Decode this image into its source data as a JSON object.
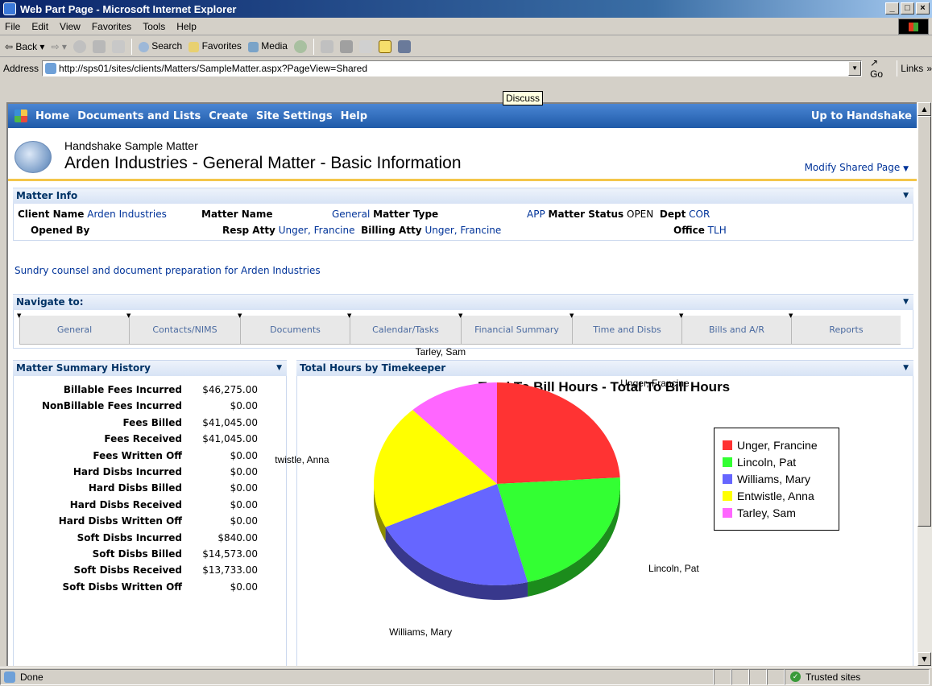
{
  "window": {
    "title": "Web Part Page - Microsoft Internet Explorer"
  },
  "menu": [
    "File",
    "Edit",
    "View",
    "Favorites",
    "Tools",
    "Help"
  ],
  "toolbar": {
    "back": "Back",
    "search": "Search",
    "favorites": "Favorites",
    "media": "Media"
  },
  "address": {
    "label": "Address",
    "url": "http://sps01/sites/clients/Matters/SampleMatter.aspx?PageView=Shared",
    "go": "Go",
    "links": "Links"
  },
  "tooltip": "Discuss",
  "topnav": {
    "items": [
      "Home",
      "Documents and Lists",
      "Create",
      "Site Settings",
      "Help"
    ],
    "right": "Up to Handshake"
  },
  "header": {
    "subtitle": "Handshake Sample Matter",
    "title": "Arden Industries - General Matter - Basic Information",
    "modify": "Modify Shared Page"
  },
  "matter_info": {
    "title": "Matter Info",
    "client_name_label": "Client Name",
    "client_name": "Arden Industries",
    "matter_name_label": "Matter Name",
    "matter_name": "General",
    "matter_type_label": "Matter Type",
    "matter_type": "APP",
    "matter_status_label": "Matter Status",
    "matter_status": "OPEN",
    "dept_label": "Dept",
    "dept": "COR",
    "opened_by_label": "Opened By",
    "resp_atty_label": "Resp Atty",
    "resp_atty": "Unger, Francine",
    "billing_atty_label": "Billing Atty",
    "billing_atty": "Unger, Francine",
    "office_label": "Office",
    "office": "TLH"
  },
  "description": "Sundry counsel and document preparation for Arden Industries",
  "navigate": {
    "title": "Navigate to:",
    "tabs": [
      "General",
      "Contacts/NIMS",
      "Documents",
      "Calendar/Tasks",
      "Financial Summary",
      "Time and Disbs",
      "Bills and A/R",
      "Reports"
    ]
  },
  "summary": {
    "title": "Matter Summary History",
    "rows": [
      {
        "label": "Billable Fees Incurred",
        "value": "$46,275.00"
      },
      {
        "label": "NonBillable Fees Incurred",
        "value": "$0.00"
      },
      {
        "label": "Fees Billed",
        "value": "$41,045.00"
      },
      {
        "label": "Fees Received",
        "value": "$41,045.00"
      },
      {
        "label": "Fees Written Off",
        "value": "$0.00"
      },
      {
        "label": "Hard Disbs Incurred",
        "value": "$0.00"
      },
      {
        "label": "Hard Disbs Billed",
        "value": "$0.00"
      },
      {
        "label": "Hard Disbs Received",
        "value": "$0.00"
      },
      {
        "label": "Hard Disbs Written Off",
        "value": "$0.00"
      },
      {
        "label": "Soft Disbs Incurred",
        "value": "$840.00"
      },
      {
        "label": "Soft Disbs Billed",
        "value": "$14,573.00"
      },
      {
        "label": "Soft Disbs Received",
        "value": "$13,733.00"
      },
      {
        "label": "Soft Disbs Written Off",
        "value": "$0.00"
      }
    ]
  },
  "hours": {
    "title": "Total Hours by Timekeeper"
  },
  "chart_data": {
    "type": "pie",
    "title": "Total To Bill Hours - Total To Bill Hours",
    "legend_position": "right",
    "categories": [
      "Unger, Francine",
      "Lincoln, Pat",
      "Williams, Mary",
      "Entwistle, Anna",
      "Tarley, Sam"
    ],
    "values": [
      24,
      22,
      22,
      20,
      12
    ],
    "colors": [
      "#ff3333",
      "#33ff33",
      "#6666ff",
      "#ffff00",
      "#ff66ff"
    ],
    "slice_labels": [
      "Unger, Francine",
      "Lincoln, Pat",
      "Williams, Mary",
      "twistle, Anna",
      "Tarley, Sam"
    ]
  },
  "status": {
    "text": "Done",
    "zone": "Trusted sites"
  }
}
